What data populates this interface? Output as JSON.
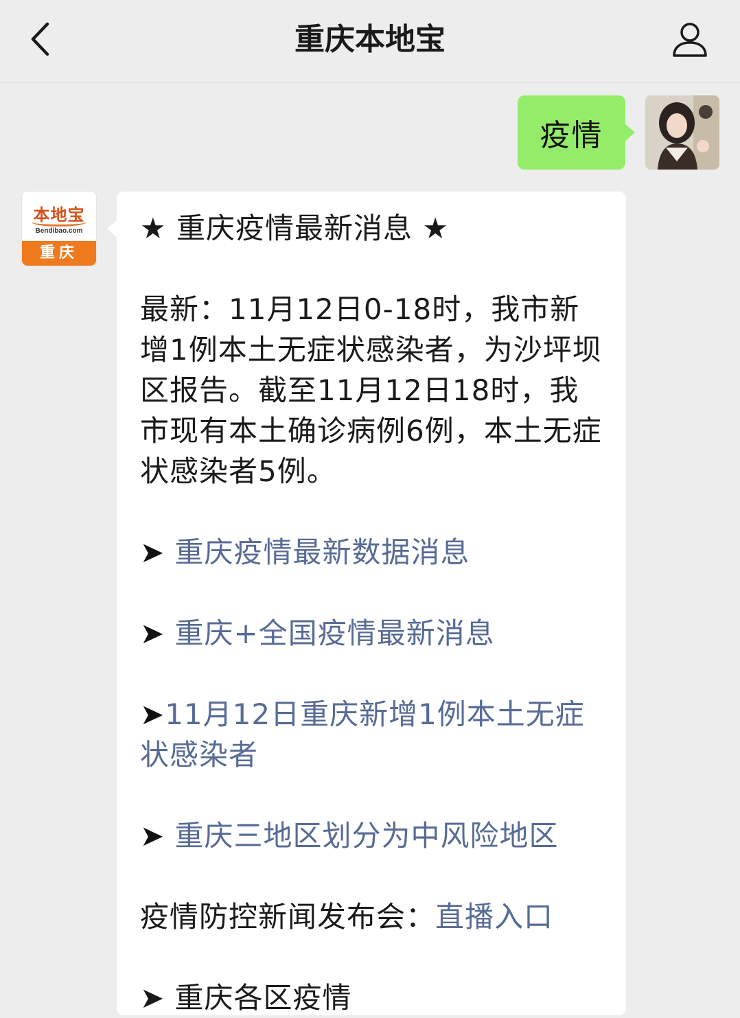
{
  "header": {
    "title": "重庆本地宝",
    "back_icon": "chevron-left-icon",
    "profile_icon": "user-icon"
  },
  "user_message": {
    "text": "疫情",
    "bubble_color": "#95ec69"
  },
  "bot": {
    "logo_main": "本地宝",
    "logo_sub": "Bendibao.com",
    "logo_city": "重庆",
    "brand_color": "#f07a1e"
  },
  "bot_message": {
    "title": "★ 重庆疫情最新消息 ★",
    "body": "最新：11月12日0-18时，我市新增1例本土无症状感染者，为沙坪坝区报告。截至11月12日18时，我市现有本土确诊病例6例，本土无症状感染者5例。",
    "links": [
      {
        "arrow": "➤ ",
        "label": "重庆疫情最新数据消息"
      },
      {
        "arrow": "➤ ",
        "label": "重庆+全国疫情最新消息"
      },
      {
        "arrow": "➤",
        "label": "11月12日重庆新增1例本土无症状感染者"
      },
      {
        "arrow": "➤ ",
        "label": "重庆三地区划分为中风险地区"
      }
    ],
    "press_label": "疫情防控新闻发布会：",
    "press_link": "直播入口",
    "partial_next": "➤ 重庆各区疫情",
    "link_color": "#576b95"
  }
}
